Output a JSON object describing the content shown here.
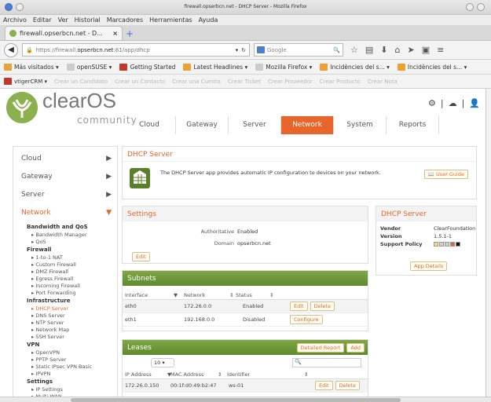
{
  "window": {
    "title": "firewall.opserbcn.net - DHCP Server - Mozilla Firefox"
  },
  "menu": [
    "Archivo",
    "Editar",
    "Ver",
    "Historial",
    "Marcadores",
    "Herramientas",
    "Ayuda"
  ],
  "tab": {
    "label": "firewall.opserbcn.net - D...",
    "close": "×",
    "new": "+"
  },
  "nav": {
    "url_host": "https://firewall.",
    "url_bold": "opserbcn.net",
    "url_rest": ":81/app/dhcp",
    "search_engine": "Google",
    "search_placeholder": "Google"
  },
  "bookmarks": [
    {
      "label": "Más visitados ▾",
      "color": "#e8a33a"
    },
    {
      "label": "openSUSE ▾",
      "color": "#cccccc"
    },
    {
      "label": "Getting Started",
      "color": "#c0392b"
    },
    {
      "label": "Latest Headlines ▾",
      "color": "#f0a030"
    },
    {
      "label": "Mozilla Firefox ▾",
      "color": "#cccccc"
    },
    {
      "label": "Incidències del s... ▾",
      "color": "#f0a030"
    },
    {
      "label": "Incidències del s... ▾",
      "color": "#f0a030"
    }
  ],
  "crm": {
    "main": "vtigerCRM ▾",
    "items": [
      "Crear un Candidato",
      "Crear un Contacto",
      "Crear una Cuenta",
      "Crear Ticket",
      "Crear Proveedor",
      "Crear Producto",
      "Crear Nota"
    ]
  },
  "brand": {
    "name": "clearOS",
    "sub": "community"
  },
  "main_nav": [
    "Cloud",
    "Gateway",
    "Server",
    "Network",
    "System",
    "Reports"
  ],
  "main_nav_active": "Network",
  "sidebar": {
    "top": [
      {
        "label": "Cloud",
        "arrow": "▶"
      },
      {
        "label": "Gateway",
        "arrow": "▶"
      },
      {
        "label": "Server",
        "arrow": "▶"
      },
      {
        "label": "Network",
        "arrow": "▼"
      }
    ],
    "groups": [
      {
        "title": "Bandwidth and QoS",
        "items": [
          "Bandwidth Manager",
          "QoS"
        ]
      },
      {
        "title": "Firewall",
        "items": [
          "1-to-1 NAT",
          "Custom Firewall",
          "DMZ Firewall",
          "Egress Firewall",
          "Incoming Firewall",
          "Port Forwarding"
        ]
      },
      {
        "title": "Infrastructure",
        "items": [
          "DHCP Server",
          "DNS Server",
          "NTP Server",
          "Network Map",
          "SSH Server"
        ]
      },
      {
        "title": "VPN",
        "items": [
          "OpenVPN",
          "PPTP Server",
          "Static IPsec VPN Basic",
          "IPVPN"
        ]
      },
      {
        "title": "Settings",
        "items": [
          "IP Settings",
          "Multi-WAN"
        ]
      }
    ],
    "active_item": "DHCP Server"
  },
  "intro": {
    "title": "DHCP Server",
    "description": "The DHCP Server app provides automatic IP configuration to devices on your network.",
    "guide_button": "User Guide"
  },
  "settings": {
    "title": "Settings",
    "authoritative_label": "Authoritative",
    "authoritative_value": "Enabled",
    "domain_label": "Domain",
    "domain_value": "opserbcn.net",
    "edit_button": "Edit"
  },
  "info": {
    "title": "DHCP Server",
    "vendor_label": "Vendor",
    "vendor_value": "ClearFoundation",
    "version_label": "Version",
    "version_value": "1.5.1-1",
    "support_label": "Support Policy",
    "details_button": "App Details",
    "support_colors": [
      "#f0e070",
      "#cfcfcf",
      "#cfcfcf",
      "#e8662b",
      "#111111"
    ]
  },
  "subnets": {
    "title": "Subnets",
    "headers": [
      "Interface",
      "Network",
      "Status"
    ],
    "rows": [
      {
        "interface": "eth0",
        "network": "172.26.0.0",
        "status": "Enabled",
        "actions": [
          "Edit",
          "Delete"
        ]
      },
      {
        "interface": "eth1",
        "network": "192.168.0.0",
        "status": "Disabled",
        "actions": [
          "Configure"
        ]
      }
    ]
  },
  "leases": {
    "title": "Leases",
    "report_button": "Detailed Report",
    "add_button": "Add",
    "page_size": "10",
    "headers": [
      "IP Address",
      "MAC Address",
      "Identifier"
    ],
    "rows": [
      {
        "ip": "172.26.0.150",
        "mac": "00:1f:d0:49:b2:47",
        "id": "ws-01",
        "actions": [
          "Edit",
          "Delete"
        ]
      }
    ]
  }
}
